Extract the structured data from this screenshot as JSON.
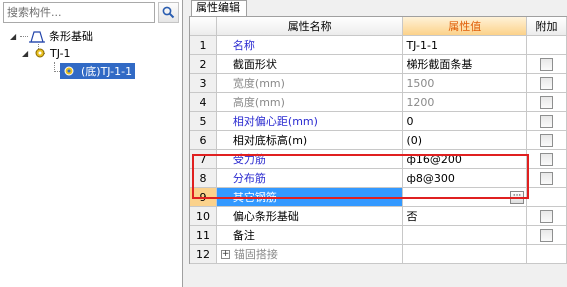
{
  "search": {
    "placeholder": "搜索构件..."
  },
  "tree": {
    "root": "条形基础",
    "child": "TJ-1",
    "leaf": "(底)TJ-1-1"
  },
  "panel": {
    "tab_label": "属性编辑"
  },
  "table": {
    "headers": [
      "属性名称",
      "属性值",
      "附加"
    ],
    "rows": [
      {
        "num": "1",
        "name": "名称",
        "value": "TJ-1-1"
      },
      {
        "num": "2",
        "name": "截面形状",
        "value": "梯形截面条基"
      },
      {
        "num": "3",
        "name": "宽度(mm)",
        "value": "1500"
      },
      {
        "num": "4",
        "name": "高度(mm)",
        "value": "1200"
      },
      {
        "num": "5",
        "name": "相对偏心距(mm)",
        "value": "0"
      },
      {
        "num": "6",
        "name": "相对底标高(m)",
        "value": "(0)"
      },
      {
        "num": "7",
        "name": "受力筋",
        "value": "ф16@200"
      },
      {
        "num": "8",
        "name": "分布筋",
        "value": "ф8@300"
      },
      {
        "num": "9",
        "name": "其它钢筋",
        "value": ""
      },
      {
        "num": "10",
        "name": "偏心条形基础",
        "value": "否"
      },
      {
        "num": "11",
        "name": "备注",
        "value": ""
      },
      {
        "num": "12",
        "name": "锚固搭接",
        "value": ""
      }
    ]
  },
  "colors": {
    "highlight": "#e02020",
    "selection": "#3399ff",
    "link_text": "#2b2bd0"
  }
}
